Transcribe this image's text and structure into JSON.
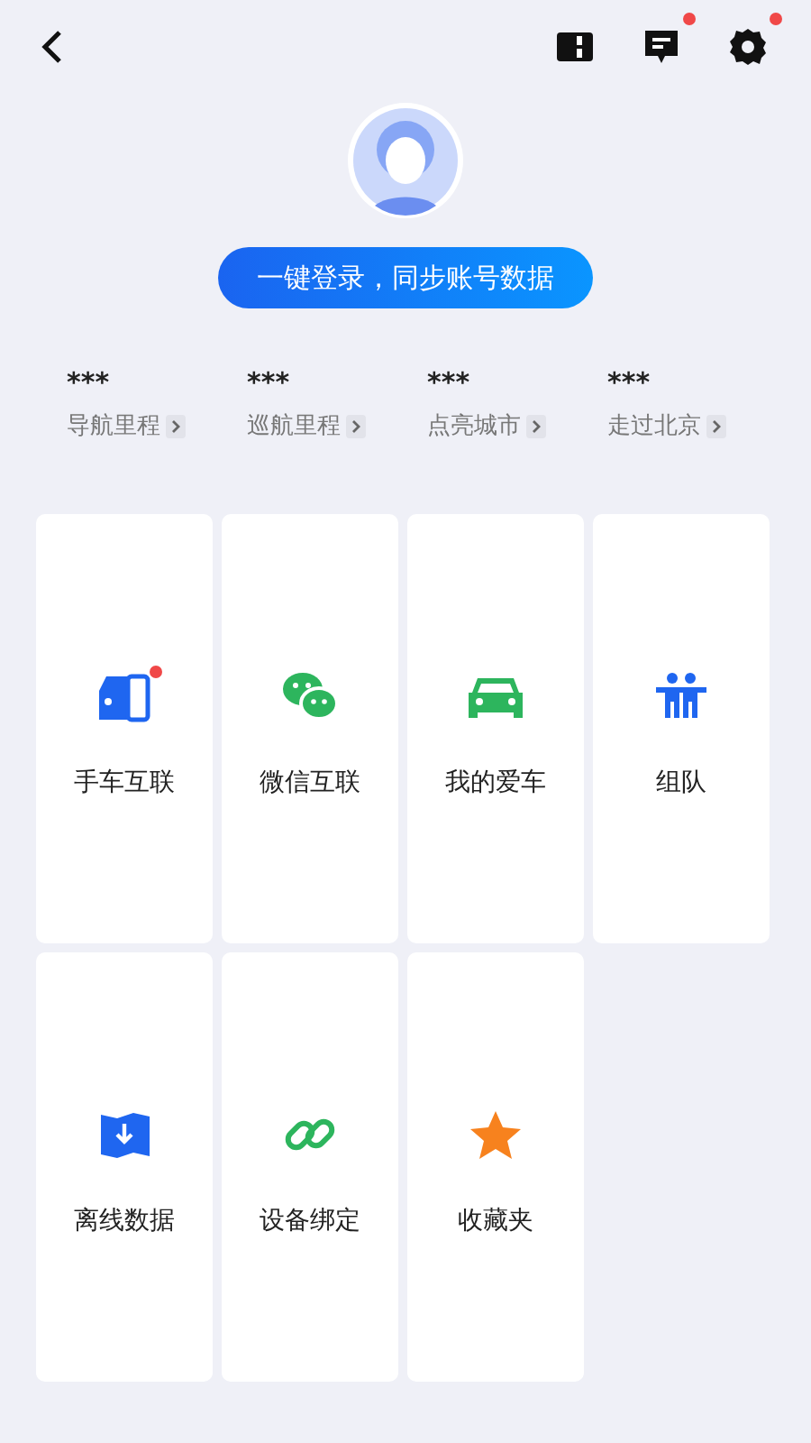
{
  "toolbar": {
    "icons": [
      {
        "kind": "book",
        "badge": false
      },
      {
        "kind": "message",
        "badge": true
      },
      {
        "kind": "settings",
        "badge": true
      }
    ]
  },
  "login_button": "一键登录，同步账号数据",
  "stats": [
    {
      "value": "***",
      "label": "导航里程"
    },
    {
      "value": "***",
      "label": "巡航里程"
    },
    {
      "value": "***",
      "label": "点亮城市"
    },
    {
      "value": "***",
      "label": "走过北京"
    }
  ],
  "tiles": [
    {
      "kind": "phone-car",
      "label": "手车互联",
      "badge": true
    },
    {
      "kind": "chat",
      "label": "微信互联",
      "badge": false
    },
    {
      "kind": "car",
      "label": "我的爱车",
      "badge": false
    },
    {
      "kind": "team",
      "label": "组队",
      "badge": false
    },
    {
      "kind": "map",
      "label": "离线数据",
      "badge": false
    },
    {
      "kind": "link",
      "label": "设备绑定",
      "badge": false
    },
    {
      "kind": "star",
      "label": "收藏夹",
      "badge": false
    }
  ]
}
